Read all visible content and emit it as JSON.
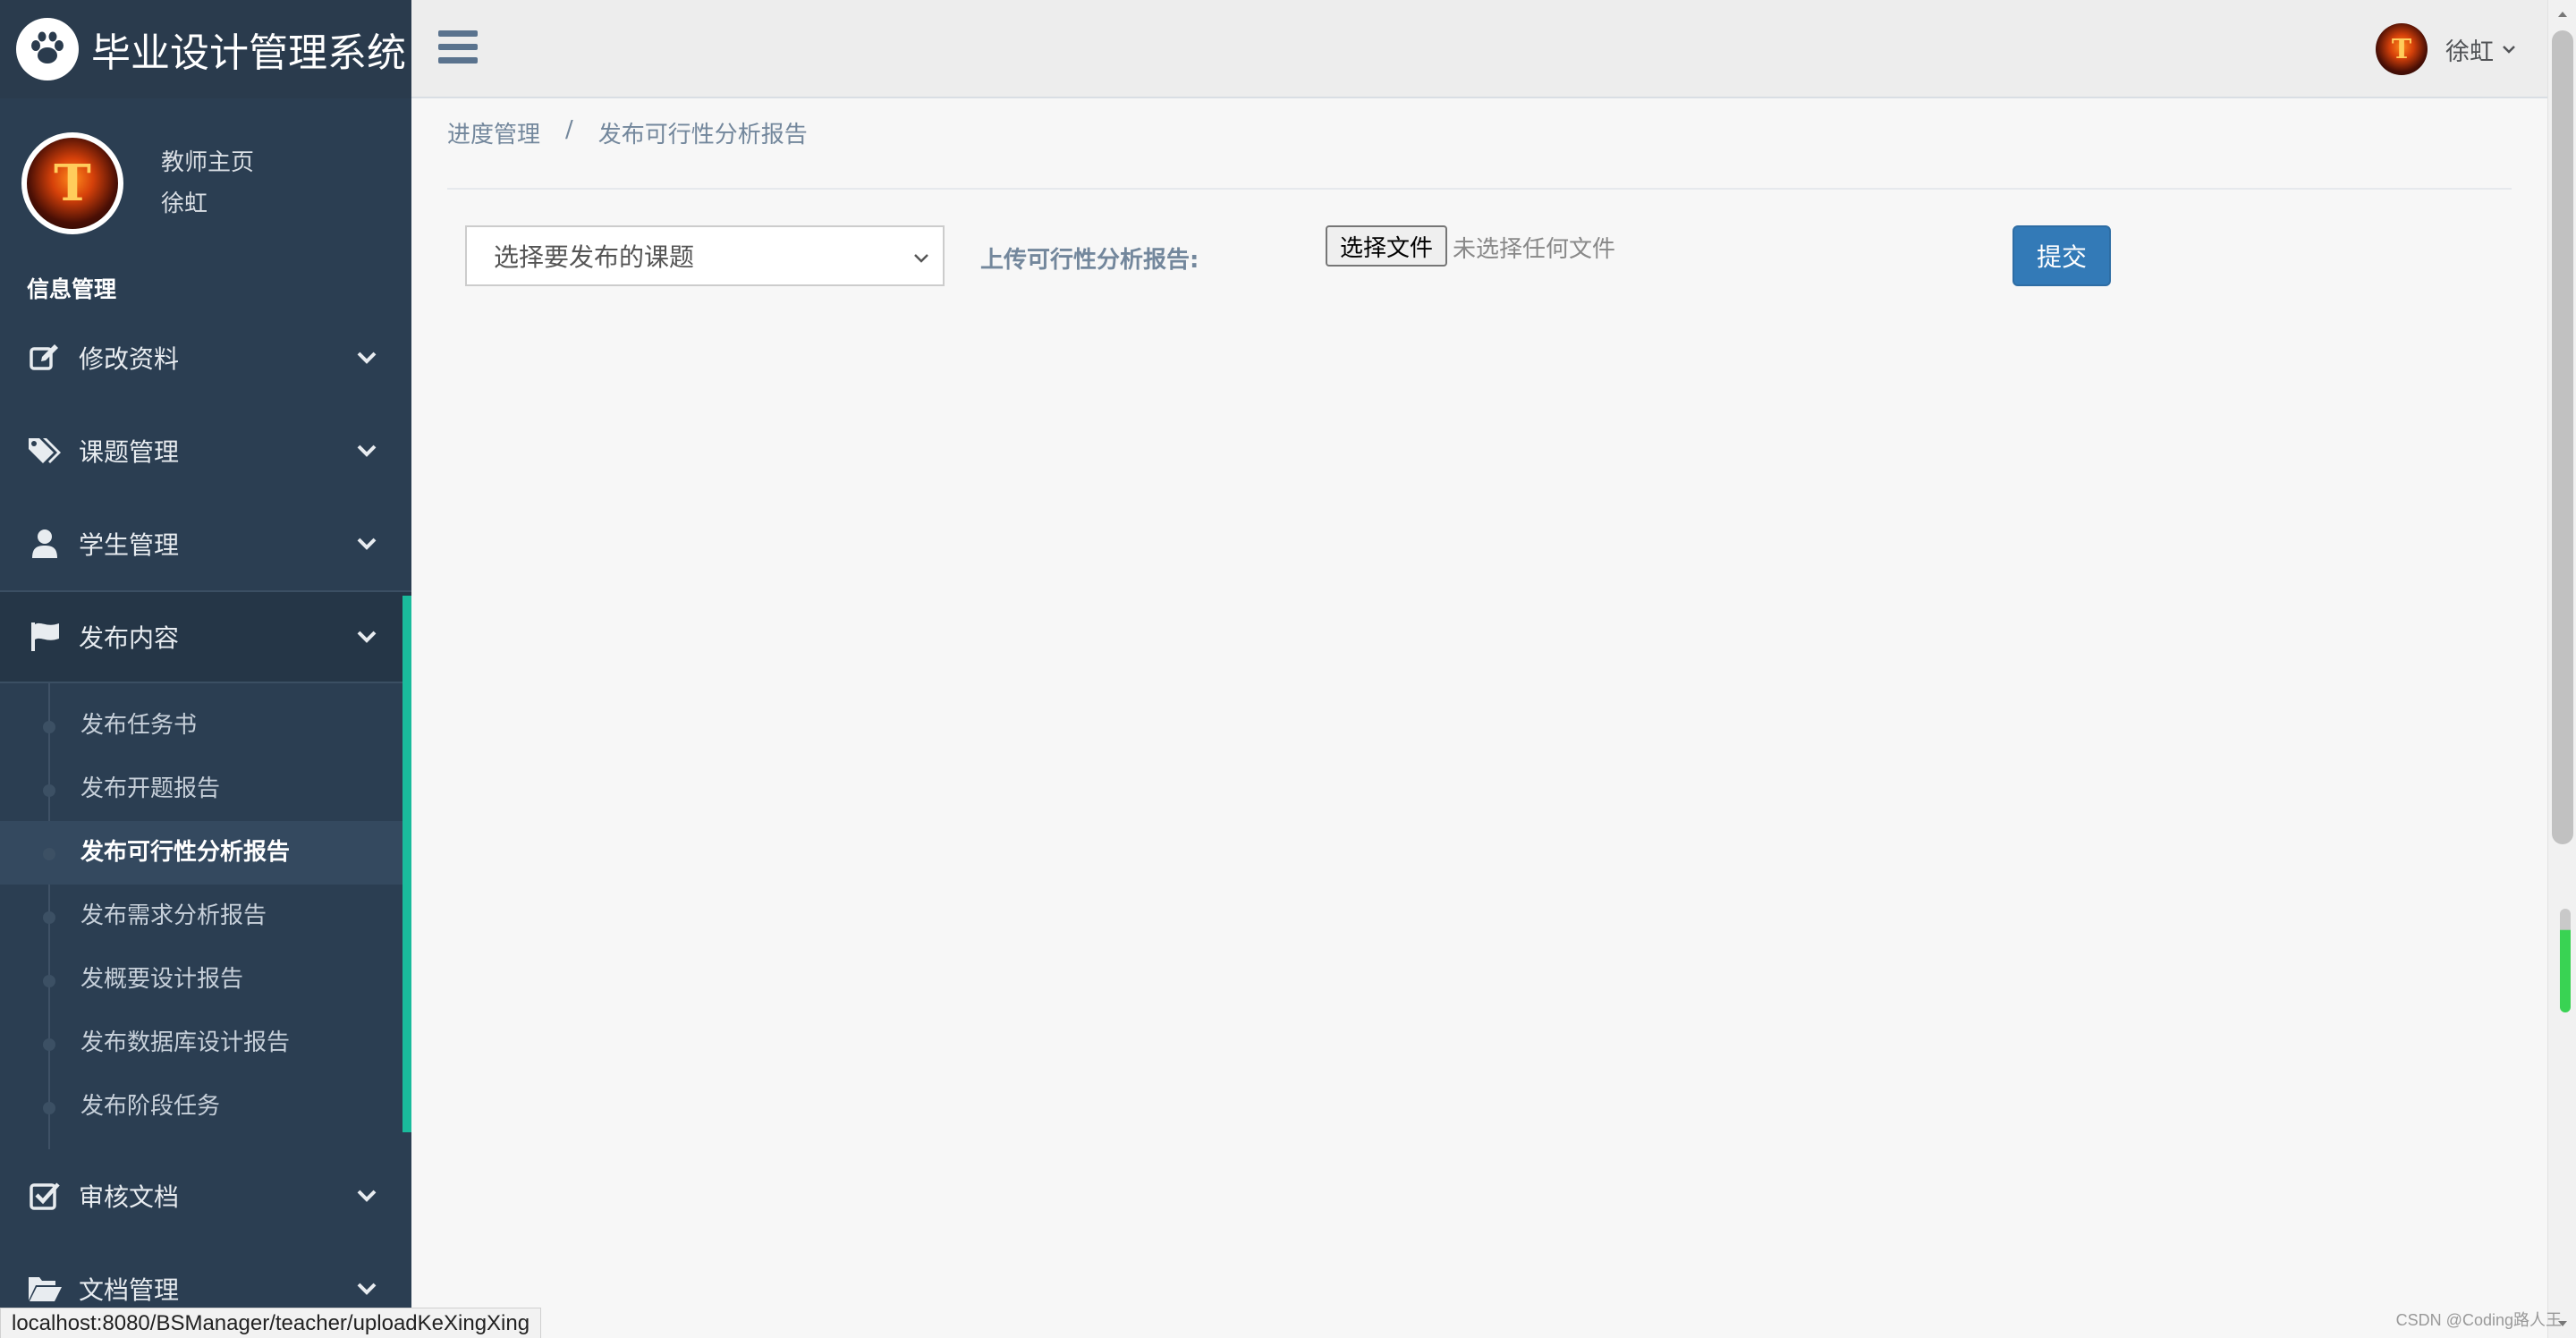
{
  "app": {
    "title": "毕业设计管理系统"
  },
  "profile": {
    "role": "教师主页",
    "name": "徐虹"
  },
  "sidebar": {
    "section_label": "信息管理",
    "items": [
      {
        "label": "修改资料",
        "icon": "edit-icon"
      },
      {
        "label": "课题管理",
        "icon": "tags-icon"
      },
      {
        "label": "学生管理",
        "icon": "user-icon"
      },
      {
        "label": "发布内容",
        "icon": "flag-icon",
        "expanded": true
      },
      {
        "label": "审核文档",
        "icon": "check-square-icon"
      },
      {
        "label": "文档管理",
        "icon": "folder-open-icon"
      }
    ],
    "submenu": [
      "发布任务书",
      "发布开题报告",
      "发布可行性分析报告",
      "发布需求分析报告",
      "发概要设计报告",
      "发布数据库设计报告",
      "发布阶段任务"
    ],
    "current_sub": "发布可行性分析报告"
  },
  "header": {
    "user_name": "徐虹"
  },
  "breadcrumb": {
    "parent": "进度管理",
    "separator": "/",
    "current": "发布可行性分析报告"
  },
  "form": {
    "select_placeholder": "选择要发布的课题",
    "upload_label": "上传可行性分析报告:",
    "file_button": "选择文件",
    "file_status": "未选择任何文件",
    "submit_label": "提交"
  },
  "status_bar": {
    "url": "localhost:8080/BSManager/teacher/uploadKeXingXing"
  },
  "watermark": "CSDN @Coding路人王",
  "colors": {
    "sidebar_bg": "#2b3e52",
    "accent": "#1abb9c",
    "primary_button": "#337ab7"
  }
}
